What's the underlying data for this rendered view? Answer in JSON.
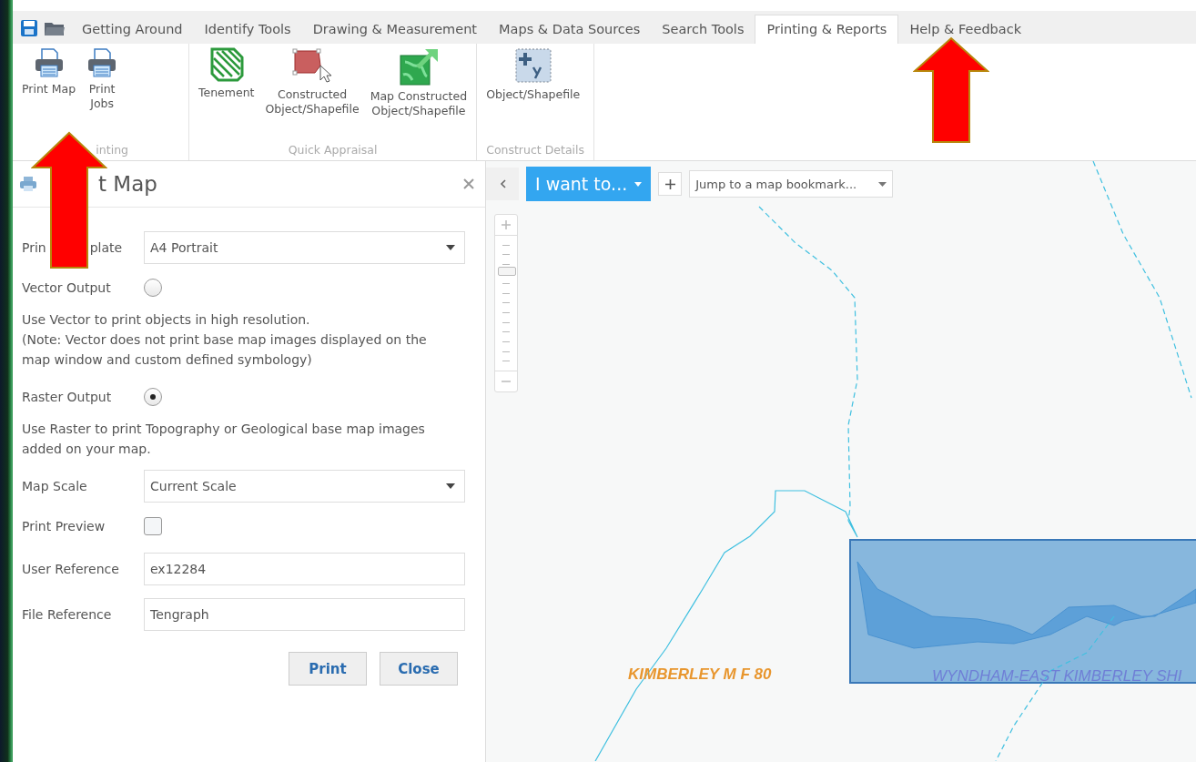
{
  "tabs": [
    {
      "label": "Getting Around",
      "selected": false
    },
    {
      "label": "Identify Tools",
      "selected": false
    },
    {
      "label": "Drawing & Measurement",
      "selected": false
    },
    {
      "label": "Maps & Data Sources",
      "selected": false
    },
    {
      "label": "Search Tools",
      "selected": false
    },
    {
      "label": "Printing & Reports",
      "selected": true
    },
    {
      "label": "Help & Feedback",
      "selected": false
    }
  ],
  "ribbon_groups": [
    {
      "label": "inting",
      "buttons": [
        {
          "label": "Print Map"
        },
        {
          "label": "Print\nJobs"
        }
      ]
    },
    {
      "label": "Quick Appraisal",
      "buttons": [
        {
          "label": "Tenement"
        },
        {
          "label": "Constructed\nObject/Shapefile"
        },
        {
          "label": "Map Constructed\nObject/Shapefile"
        }
      ]
    },
    {
      "label": "Construct Details",
      "buttons": [
        {
          "label": "Object/Shapefile"
        }
      ]
    }
  ],
  "panel": {
    "title": "t Map",
    "rows": [
      {
        "kind": "select",
        "label": "Prin",
        "label_tail": "plate",
        "value": "A4 Portrait"
      },
      {
        "kind": "radio",
        "label": "Vector Output",
        "selected": false
      },
      {
        "kind": "note",
        "text": "Use Vector to print objects in high resolution.\n(Note: Vector does not print base map images displayed on the map window and custom defined symbology)"
      },
      {
        "kind": "radio",
        "label": "Raster Output",
        "selected": true
      },
      {
        "kind": "note",
        "text": "Use Raster to print Topography or Geological base map images added on your map."
      },
      {
        "kind": "select",
        "label": "Map Scale",
        "value": "Current Scale"
      },
      {
        "kind": "checkbox",
        "label": "Print Preview",
        "checked": false
      },
      {
        "kind": "text",
        "label": "User Reference",
        "value": "ex12284"
      },
      {
        "kind": "text",
        "label": "File Reference",
        "value": "Tengraph"
      }
    ],
    "buttons": [
      "Print",
      "Close"
    ]
  },
  "map": {
    "i_want_to": "I want to...",
    "bookmark": {
      "placeholder": "Jump to a map bookmark..."
    },
    "zoom": {
      "level": 0.77
    },
    "labels": [
      {
        "text": "KIMBERLEY M F 80",
        "color": "#e8962e"
      },
      {
        "text": "WYNDHAM-EAST KIMBERLEY SHI",
        "color": "#6f7fd6"
      }
    ]
  }
}
